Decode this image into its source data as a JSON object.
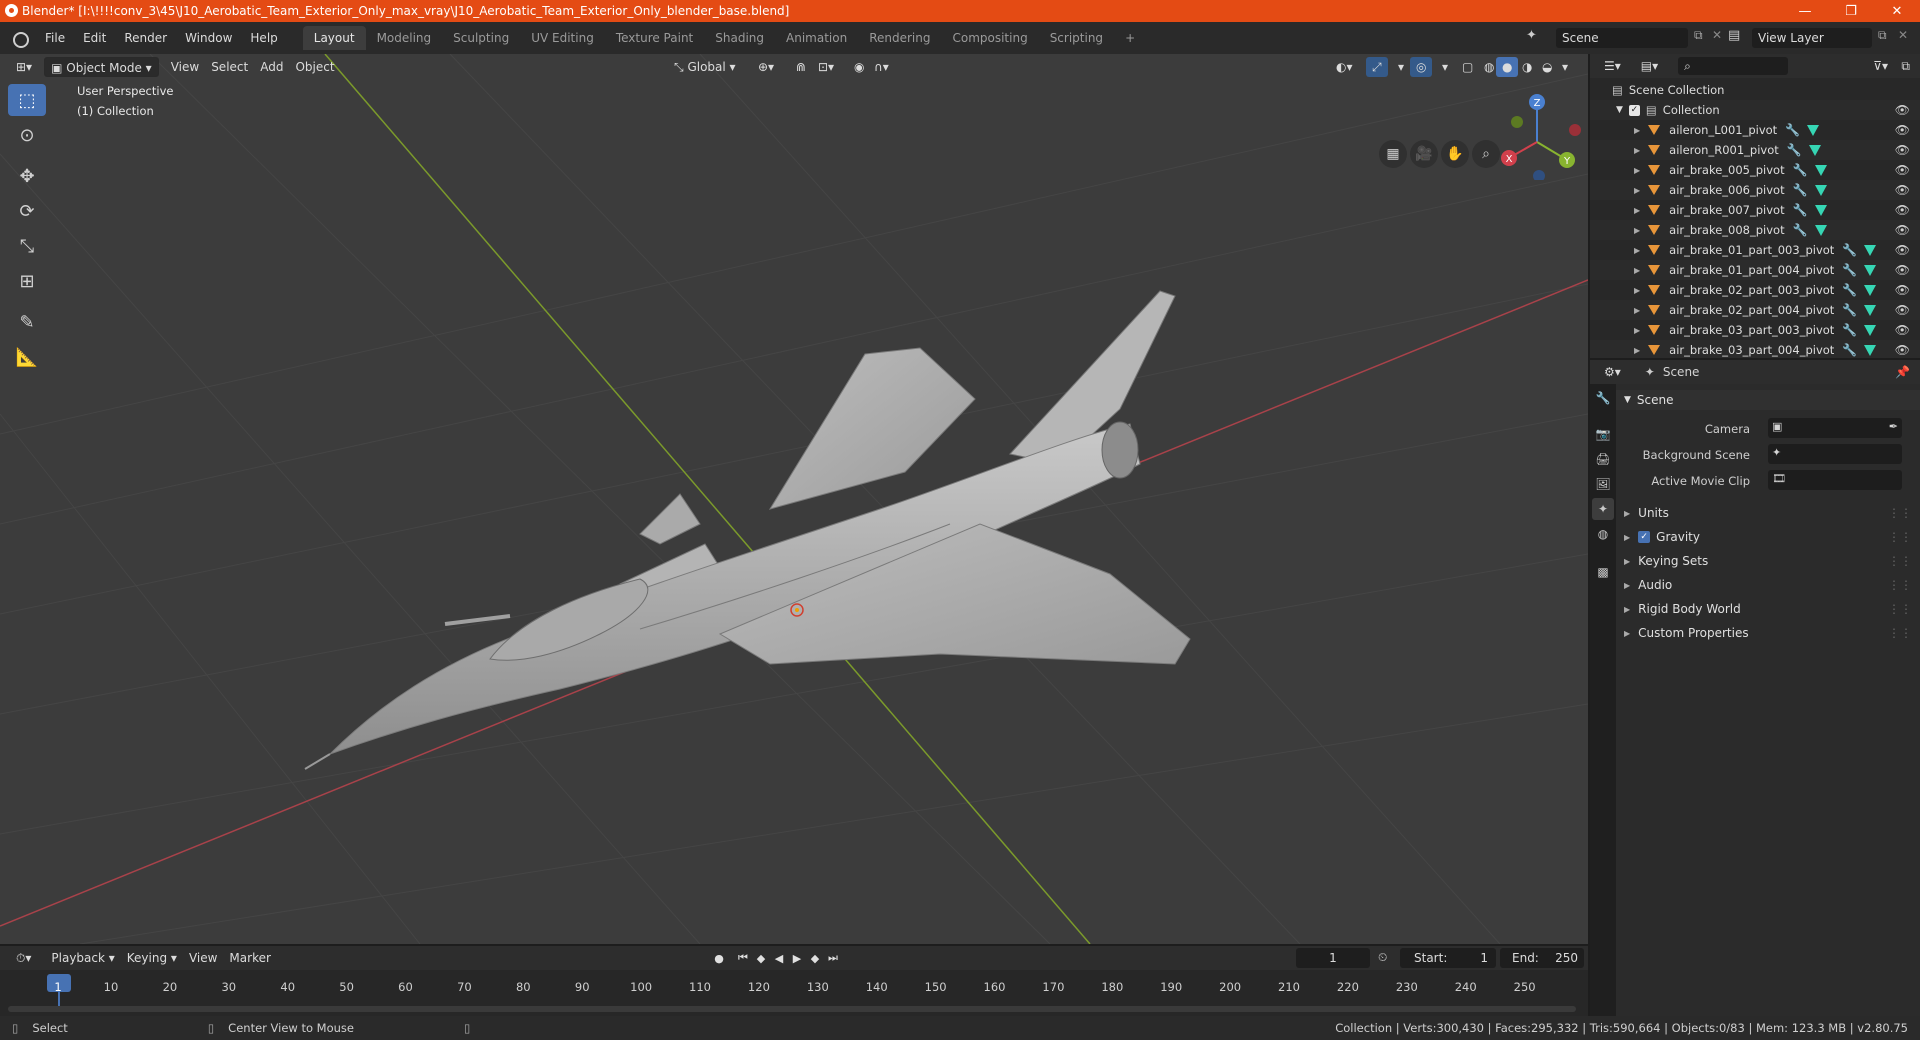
{
  "window": {
    "title": "Blender* [I:\\!!!!conv_3\\45\\J10_Aerobatic_Team_Exterior_Only_max_vray\\J10_Aerobatic_Team_Exterior_Only_blender_base.blend]",
    "minimize": "—",
    "maximize": "❐",
    "close": "✕"
  },
  "menus": [
    "File",
    "Edit",
    "Render",
    "Window",
    "Help"
  ],
  "workspaces": [
    "Layout",
    "Modeling",
    "Sculpting",
    "UV Editing",
    "Texture Paint",
    "Shading",
    "Animation",
    "Rendering",
    "Compositing",
    "Scripting"
  ],
  "workspace_add": "+",
  "scene_field": "Scene",
  "view_layer_field": "View Layer",
  "viewport": {
    "mode": "Object Mode",
    "menu": [
      "View",
      "Select",
      "Add",
      "Object"
    ],
    "orientation": "Global",
    "perspective_label": "User Perspective",
    "collection_label": "(1) Collection",
    "colors": {
      "bg": "#3c3c3c",
      "x_axis": "#b0424a",
      "y_axis": "#7c9a2a",
      "grid": "#464646"
    }
  },
  "gizmo": {
    "x": "X",
    "y": "Y",
    "z": "Z"
  },
  "outliner": {
    "root": "Scene Collection",
    "collection": "Collection",
    "items": [
      "aileron_L001_pivot",
      "aileron_R001_pivot",
      "air_brake_005_pivot",
      "air_brake_006_pivot",
      "air_brake_007_pivot",
      "air_brake_008_pivot",
      "air_brake_01_part_003_pivot",
      "air_brake_01_part_004_pivot",
      "air_brake_02_part_003_pivot",
      "air_brake_02_part_004_pivot",
      "air_brake_03_part_003_pivot",
      "air_brake_03_part_004_pivot"
    ]
  },
  "properties": {
    "context": "Scene",
    "section_scene": "Scene",
    "camera_label": "Camera",
    "background_scene_label": "Background Scene",
    "active_movie_clip_label": "Active Movie Clip",
    "panels": [
      "Units",
      "Gravity",
      "Keying Sets",
      "Audio",
      "Rigid Body World",
      "Custom Properties"
    ]
  },
  "timeline": {
    "menu": [
      "Playback",
      "Keying",
      "View",
      "Marker"
    ],
    "current_frame": "1",
    "start_label": "Start:",
    "start": "1",
    "end_label": "End:",
    "end": "250",
    "ticks": [
      "1",
      "10",
      "20",
      "30",
      "40",
      "50",
      "60",
      "70",
      "80",
      "90",
      "100",
      "110",
      "120",
      "130",
      "140",
      "150",
      "160",
      "170",
      "180",
      "190",
      "200",
      "210",
      "220",
      "230",
      "240",
      "250"
    ]
  },
  "status": {
    "select": "Select",
    "center_view": "Center View to Mouse",
    "stats": "Collection | Verts:300,430 | Faces:295,332 | Tris:590,664 | Objects:0/83 | Mem: 123.3 MB | v2.80.75"
  }
}
